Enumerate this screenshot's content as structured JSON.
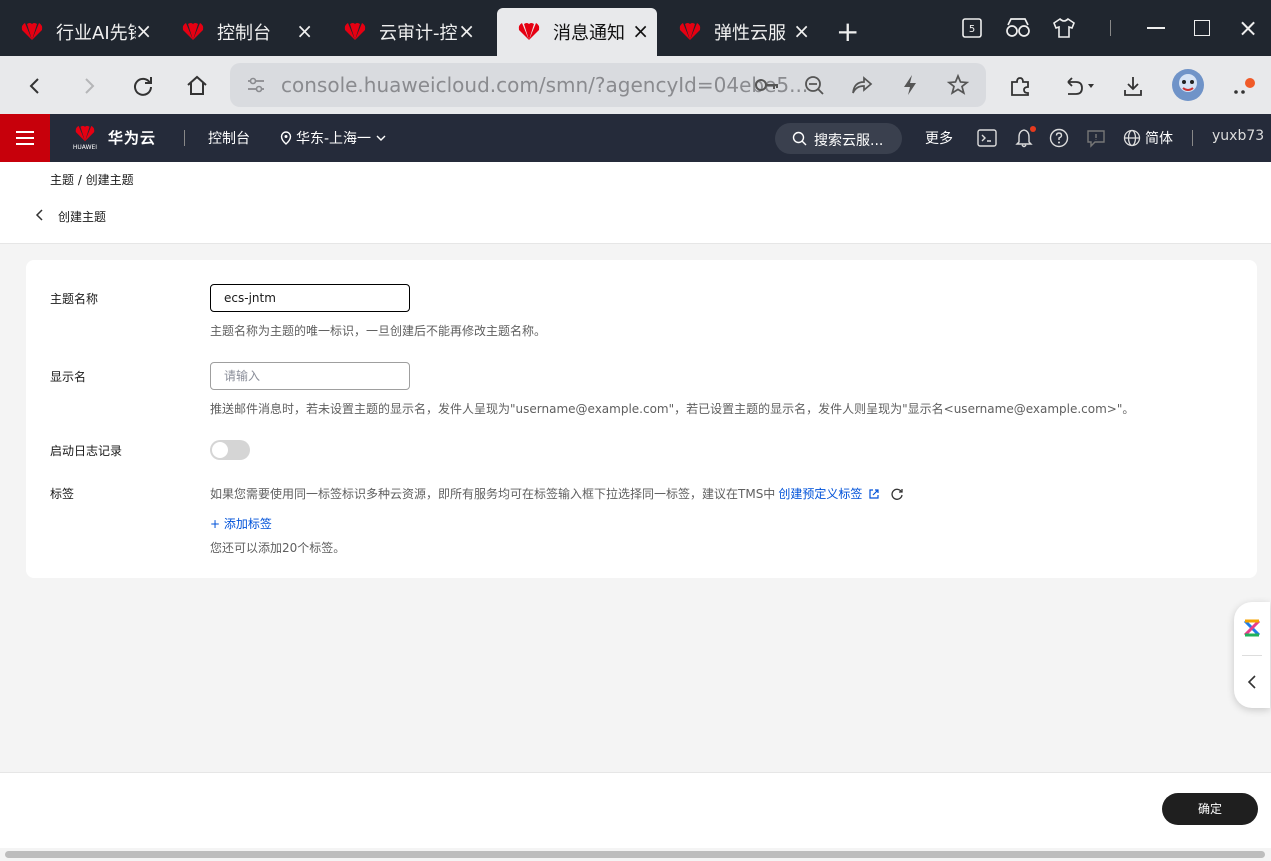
{
  "browser": {
    "tabs": [
      {
        "title": "行业AI先锋"
      },
      {
        "title": "控制台"
      },
      {
        "title": "云审计-控"
      },
      {
        "title": "消息通知"
      },
      {
        "title": "弹性云服"
      }
    ],
    "window_badge": "5",
    "address": "console.huaweicloud.com/smn/?agencyId=04ebe5..."
  },
  "console_nav": {
    "brand": "华为云",
    "logo_text": "HUAWEI",
    "console": "控制台",
    "region": "华东-上海一",
    "search": "搜索云服...",
    "more": "更多",
    "language": "简体",
    "user": "yuxb73"
  },
  "page": {
    "breadcrumb": "主题 / 创建主题",
    "title": "创建主题"
  },
  "form": {
    "topic_name_label": "主题名称",
    "topic_name_value": "ecs-jntm",
    "topic_name_help": "主题名称为主题的唯一标识，一旦创建后不能再修改主题名称。",
    "display_name_label": "显示名",
    "display_name_placeholder": "请输入",
    "display_name_help": "推送邮件消息时，若未设置主题的显示名，发件人呈现为\"username@example.com\"，若已设置主题的显示名，发件人则呈现为\"显示名<username@example.com>\"。",
    "log_label": "启动日志记录",
    "tags_label": "标签",
    "tags_help_prefix": "如果您需要使用同一标签标识多种云资源，即所有服务均可在标签输入框下拉选择同一标签，建议在TMS中",
    "tags_link": "创建预定义标签",
    "add_tag": "+ 添加标签",
    "tags_remaining": "您还可以添加20个标签。"
  },
  "footer": {
    "confirm": "确定"
  },
  "colors": {
    "brand_red": "#c7000b",
    "nav_dark": "#252b3a",
    "link_blue": "#0052d9",
    "button_dark": "#1f1f1f"
  }
}
